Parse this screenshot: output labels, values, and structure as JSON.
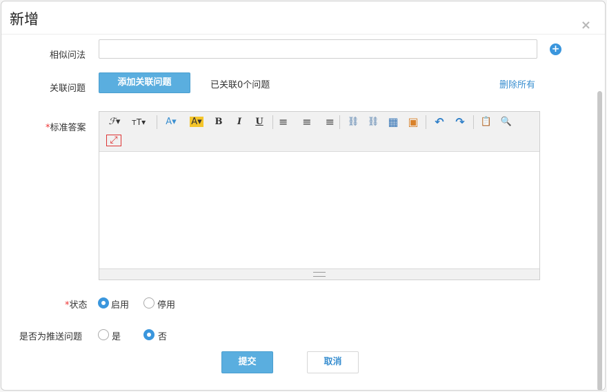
{
  "dialog": {
    "title": "新增",
    "close_glyph": "×"
  },
  "form": {
    "similar_question": {
      "label": "相似问法",
      "value": "",
      "add_icon": "plus-circle-icon"
    },
    "related_question": {
      "label": "关联问题",
      "button": "添加关联问题",
      "status": "已关联0个问题",
      "delete_all": "删除所有"
    },
    "standard_answer": {
      "required_mark": "*",
      "label": "标准答案",
      "toolbar": [
        {
          "name": "font-family-icon",
          "glyph": "ℱ▾"
        },
        {
          "name": "font-size-icon",
          "glyph": "ᴛT▾"
        },
        {
          "name": "font-color-icon",
          "glyph": "A▾"
        },
        {
          "name": "highlight-color-icon",
          "glyph": "A▾"
        },
        {
          "name": "bold-icon",
          "glyph": "B"
        },
        {
          "name": "italic-icon",
          "glyph": "I"
        },
        {
          "name": "underline-icon",
          "glyph": "U"
        },
        {
          "name": "align-left-icon",
          "glyph": "≡"
        },
        {
          "name": "align-center-icon",
          "glyph": "≡"
        },
        {
          "name": "align-right-icon",
          "glyph": "≡"
        },
        {
          "name": "link-icon",
          "glyph": "⛓"
        },
        {
          "name": "unlink-icon",
          "glyph": "⛓"
        },
        {
          "name": "table-icon",
          "glyph": "▦"
        },
        {
          "name": "image-icon",
          "glyph": "▣"
        },
        {
          "name": "undo-icon",
          "glyph": "↶"
        },
        {
          "name": "redo-icon",
          "glyph": "↷"
        },
        {
          "name": "paste-text-icon",
          "glyph": "📋"
        },
        {
          "name": "preview-icon",
          "glyph": "🔍"
        },
        {
          "name": "fullscreen-icon",
          "glyph": "⤢"
        }
      ],
      "content": ""
    },
    "status": {
      "required_mark": "*",
      "label": "状态",
      "options": [
        "启用",
        "停用"
      ],
      "selected": "启用"
    },
    "push_question": {
      "label": "是否为推送问题",
      "options": [
        "是",
        "否"
      ],
      "selected": "否"
    },
    "actions": {
      "submit": "提交",
      "cancel": "取消"
    }
  },
  "colors": {
    "accent": "#5aaedf",
    "link": "#3a8fd0",
    "required": "#e33333"
  }
}
